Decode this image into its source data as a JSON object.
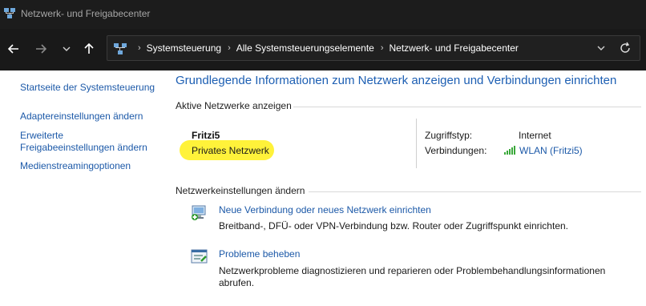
{
  "window": {
    "title": "Netzwerk- und Freigabecenter"
  },
  "breadcrumbs": [
    "Systemsteuerung",
    "Alle Systemsteuerungselemente",
    "Netzwerk- und Freigabecenter"
  ],
  "sidebar": {
    "items": [
      {
        "label": "Startseite der Systemsteuerung"
      },
      {
        "label": "Adaptereinstellungen ändern"
      },
      {
        "label": "Erweiterte\nFreigabeeinstellungen ändern"
      },
      {
        "label": "Medienstreamingoptionen"
      }
    ]
  },
  "main": {
    "title": "Grundlegende Informationen zum Netzwerk anzeigen und Verbindungen einrichten",
    "active_section": "Aktive Netzwerke anzeigen",
    "network": {
      "name": "Fritzi5",
      "type": "Privates Netzwerk",
      "access_label": "Zugriffstyp:",
      "access_value": "Internet",
      "connections_label": "Verbindungen:",
      "connections_value": "WLAN (Fritzi5)"
    },
    "settings_section": "Netzwerkeinstellungen ändern",
    "tasks": [
      {
        "link": "Neue Verbindung oder neues Netzwerk einrichten",
        "desc": "Breitband-, DFÜ- oder VPN-Verbindung bzw. Router oder Zugriffspunkt einrichten.",
        "icon": "network-setup-icon"
      },
      {
        "link": "Probleme beheben",
        "desc": "Netzwerkprobleme diagnostizieren und reparieren oder Problembehandlungsinformationen abrufen.",
        "icon": "troubleshoot-icon"
      }
    ]
  },
  "colors": {
    "titlebar": "#1c1c1c",
    "navbar": "#191919",
    "link": "#1c59a8",
    "heading": "#1d5fb3",
    "highlight": "#fff23a"
  }
}
